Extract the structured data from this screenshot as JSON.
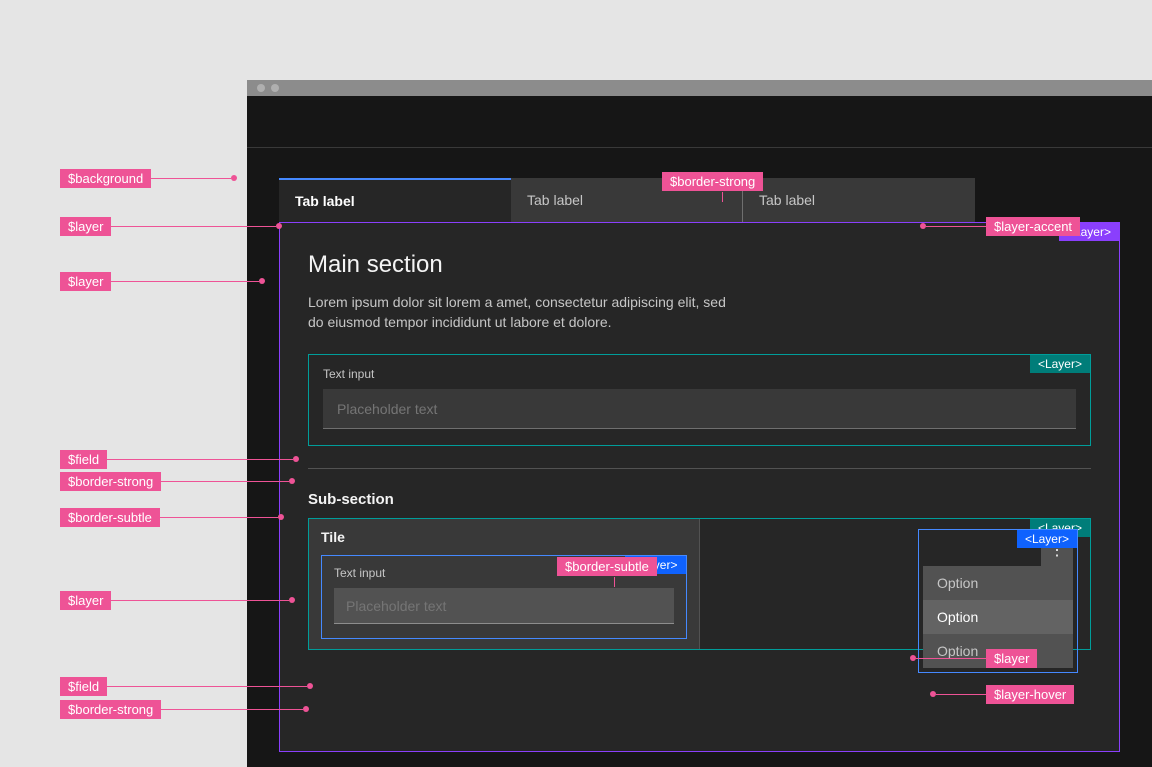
{
  "annotations": {
    "background": "$background",
    "layer_tabs": "$layer",
    "layer_panel": "$layer",
    "layer_tile": "$layer",
    "layer_menu": "$layer",
    "layer_accent": "$layer-accent",
    "layer_hover": "$layer-hover",
    "field1": "$field",
    "field2": "$field",
    "border_strong_tab": "$border-strong",
    "border_strong_input1": "$border-strong",
    "border_strong_input2": "$border-strong",
    "border_subtle1": "$border-subtle",
    "border_subtle2": "$border-subtle"
  },
  "layer_tags": {
    "purple": "<Layer>",
    "teal1": "<Layer>",
    "teal2": "<Layer>",
    "blue_tile": "<Layer>",
    "blue_menu": "<Layer>"
  },
  "tabs": {
    "selected": "Tab label",
    "inactive1": "Tab label",
    "inactive2": "Tab label"
  },
  "main": {
    "title": "Main section",
    "description": "Lorem ipsum dolor sit lorem a amet, consectetur adipiscing elit, sed do eiusmod tempor incididunt ut labore et dolore."
  },
  "input1": {
    "label": "Text input",
    "placeholder": "Placeholder text"
  },
  "sub_heading": "Sub-section",
  "tile": {
    "title": "Tile",
    "input_label": "Text input",
    "input_placeholder": "Placeholder text"
  },
  "menu": {
    "item1": "Option",
    "item2": "Option",
    "item3": "Option"
  }
}
